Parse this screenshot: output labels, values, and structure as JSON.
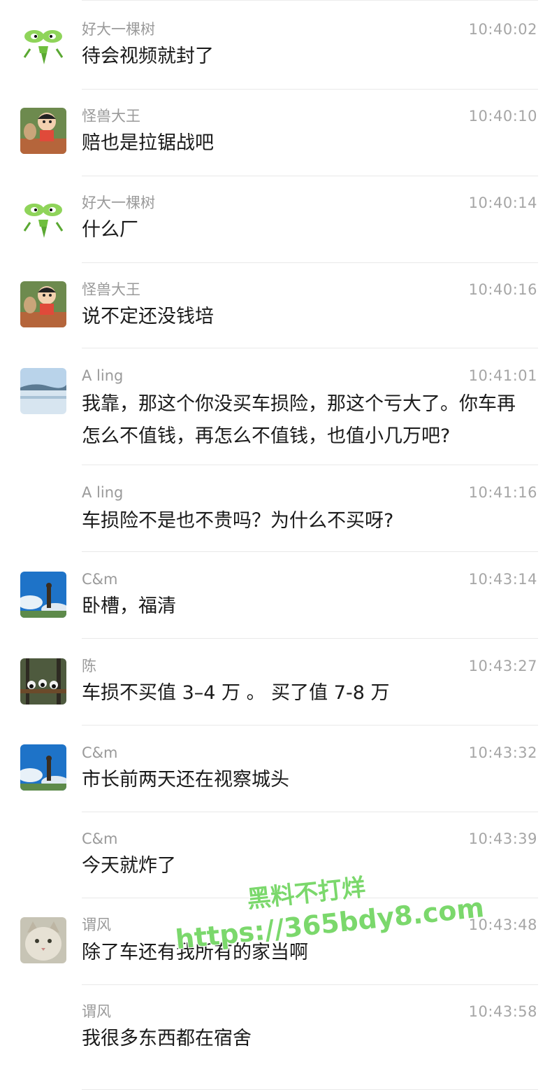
{
  "messages": [
    {
      "sender": "好大一棵树",
      "time": "10:40:02",
      "text": "待会视频就封了",
      "avatar": "mantis-avatar"
    },
    {
      "sender": "怪兽大王",
      "time": "10:40:10",
      "text": "赔也是拉锯战吧",
      "avatar": "cartoon-boy-avatar"
    },
    {
      "sender": "好大一棵树",
      "time": "10:40:14",
      "text": "什么厂",
      "avatar": "mantis-avatar"
    },
    {
      "sender": "怪兽大王",
      "time": "10:40:16",
      "text": "说不定还没钱培",
      "avatar": "cartoon-boy-avatar"
    },
    {
      "sender": "A ling",
      "time": "10:41:01",
      "text": "我靠，那这个你没买车损险，那这个亏大了。你车再怎么不值钱，再怎么不值钱，也值小几万吧?",
      "avatar": "lake-avatar"
    },
    {
      "sender": "A ling",
      "time": "10:41:16",
      "text": "车损险不是也不贵吗？为什么不买呀?",
      "avatar": null
    },
    {
      "sender": "C&m",
      "time": "10:43:14",
      "text": "卧槽，福清",
      "avatar": "sky-avatar"
    },
    {
      "sender": "陈",
      "time": "10:43:27",
      "text": "车损不买值 3–4 万 。 买了值 7-8 万",
      "avatar": "panda-avatar"
    },
    {
      "sender": "C&m",
      "time": "10:43:32",
      "text": "市长前两天还在视察城头",
      "avatar": "sky-avatar"
    },
    {
      "sender": "C&m",
      "time": "10:43:39",
      "text": "今天就炸了",
      "avatar": null
    },
    {
      "sender": "谓风",
      "time": "10:43:48",
      "text": "除了车还有我所有的家当啊",
      "avatar": "cat-avatar"
    },
    {
      "sender": "谓风",
      "time": "10:43:58",
      "text": "我很多东西都在宿舍",
      "avatar": null
    }
  ],
  "watermark": {
    "line1": "黑料不打烊",
    "line2": "https://365bdy8.com",
    "color": "#7bd86c"
  }
}
